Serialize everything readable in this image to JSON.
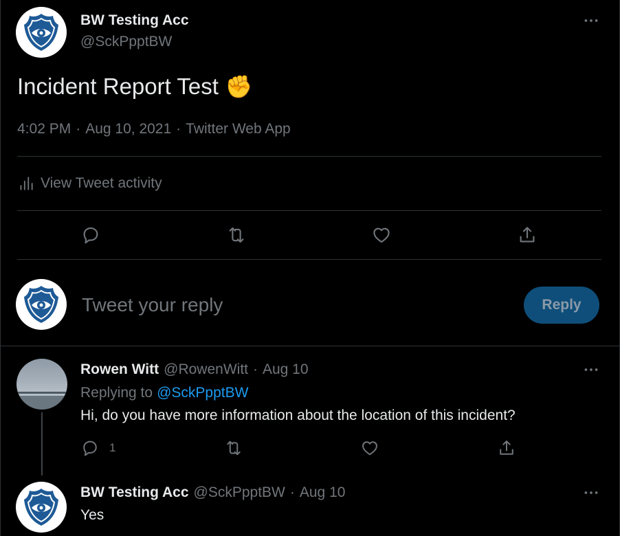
{
  "tweet": {
    "author_name": "BW Testing Acc",
    "author_handle": "@SckPpptBW",
    "text": "Incident Report Test",
    "emoji": "✊",
    "time": "4:02 PM",
    "date": "Aug 10, 2021",
    "client": "Twitter Web App",
    "sep": "·",
    "activity_label": "View Tweet activity"
  },
  "composer": {
    "placeholder": "Tweet your reply",
    "button_label": "Reply"
  },
  "replies": [
    {
      "author_name": "Rowen Witt",
      "author_handle": "@RowenWitt",
      "date": "Aug 10",
      "replying_to_prefix": "Replying to",
      "replying_to": "@SckPpptBW",
      "text": "Hi, do you have more information about the location of this incident?",
      "reply_count": "1"
    },
    {
      "author_name": "BW Testing Acc",
      "author_handle": "@SckPpptBW",
      "date": "Aug 10",
      "text": "Yes"
    }
  ],
  "colors": {
    "background": "#000000",
    "accent": "#1d9bf0",
    "badge_blue": "#1e5a96",
    "emoji_yellow": "#ffcc4d"
  },
  "icons": [
    "more-icon",
    "analytics-icon",
    "reply-icon",
    "retweet-icon",
    "like-icon",
    "share-icon",
    "police-badge-icon"
  ]
}
